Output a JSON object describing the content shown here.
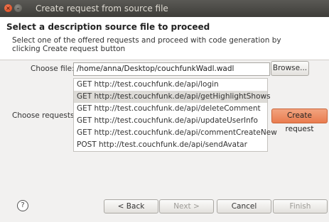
{
  "window": {
    "title": "Create request from source file"
  },
  "header": {
    "title": "Select a description source file to proceed",
    "description": "Select one of the offered requests and proceed with code generation by clicking Create request button"
  },
  "form": {
    "choose_file_label": "Choose file:",
    "file_path": "/home/anna/Desktop/couchfunkWadl.wadl",
    "browse_label": "Browse...",
    "choose_requests_label": "Choose requests:",
    "create_request_label": "Create request",
    "requests": [
      "GET http://test.couchfunk.de/api/login",
      "GET http://test.couchfunk.de/api/getHighlightShows",
      "GET http://test.couchfunk.de/api/deleteComment",
      "GET http://test.couchfunk.de/api/updateUserInfo",
      "GET http://test.couchfunk.de/api/commentCreateNew",
      "POST http://test.couchfunk.de/api/sendAvatar"
    ],
    "selected_index": 1
  },
  "footer": {
    "help_icon": "question-circle-icon",
    "help_glyph": "?",
    "back_label": "< Back",
    "next_label": "Next >",
    "cancel_label": "Cancel",
    "finish_label": "Finish"
  },
  "colors": {
    "accent": "#e97c4f",
    "selection": "#dddbd7",
    "titlebar": "#3e3d39"
  }
}
